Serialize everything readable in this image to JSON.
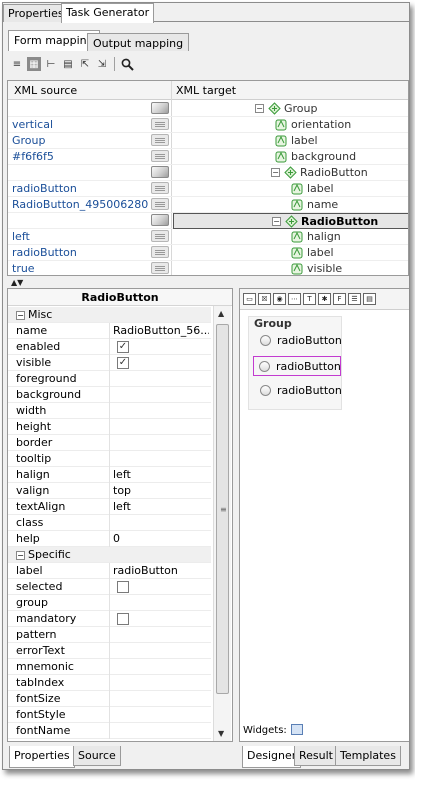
{
  "top_tabs": [
    "Properties",
    "Task Generator"
  ],
  "inner_tabs": [
    "Form mapping",
    "Output mapping"
  ],
  "toolbar_icons": [
    "list-icon",
    "grid-icon",
    "tree-icon",
    "document-icon",
    "export-icon",
    "import-icon",
    "search-icon"
  ],
  "mapping": {
    "col_source": "XML source",
    "col_target": "XML target",
    "rows": [
      {
        "source": "",
        "mid": "grad",
        "target": "Group",
        "level": 0,
        "expander": "−",
        "bold": false,
        "selected": false
      },
      {
        "source": "vertical",
        "mid": "lines",
        "target": "orientation",
        "level": 1,
        "expander": "",
        "bold": false,
        "selected": false
      },
      {
        "source": "Group",
        "mid": "lines",
        "target": "label",
        "level": 1,
        "expander": "",
        "bold": false,
        "selected": false
      },
      {
        "source": "#f6f6f5",
        "mid": "lines",
        "target": "background",
        "level": 1,
        "expander": "",
        "bold": false,
        "selected": false
      },
      {
        "source": "",
        "mid": "grad",
        "target": "RadioButton",
        "level": 1,
        "expander": "−",
        "bold": false,
        "selected": false
      },
      {
        "source": "radioButton",
        "mid": "lines",
        "target": "label",
        "level": 2,
        "expander": "",
        "bold": false,
        "selected": false
      },
      {
        "source": "RadioButton_495006280",
        "mid": "lines",
        "target": "name",
        "level": 2,
        "expander": "",
        "bold": false,
        "selected": false
      },
      {
        "source": "",
        "mid": "grad",
        "target": "RadioButton",
        "level": 1,
        "expander": "−",
        "bold": true,
        "selected": true
      },
      {
        "source": "left",
        "mid": "lines",
        "target": "halign",
        "level": 2,
        "expander": "",
        "bold": false,
        "selected": false
      },
      {
        "source": "radioButton",
        "mid": "lines",
        "target": "label",
        "level": 2,
        "expander": "",
        "bold": false,
        "selected": false
      },
      {
        "source": "true",
        "mid": "lines",
        "target": "visible",
        "level": 2,
        "expander": "",
        "bold": false,
        "selected": false
      }
    ]
  },
  "properties": {
    "title": "RadioButton",
    "rows": [
      {
        "kind": "cat",
        "name": "Misc"
      },
      {
        "kind": "text",
        "name": "name",
        "value": "RadioButton_56..."
      },
      {
        "kind": "check",
        "name": "enabled",
        "value": "✓"
      },
      {
        "kind": "check",
        "name": "visible",
        "value": "✓"
      },
      {
        "kind": "text",
        "name": "foreground",
        "value": ""
      },
      {
        "kind": "text",
        "name": "background",
        "value": ""
      },
      {
        "kind": "text",
        "name": "width",
        "value": ""
      },
      {
        "kind": "text",
        "name": "height",
        "value": ""
      },
      {
        "kind": "text",
        "name": "border",
        "value": ""
      },
      {
        "kind": "text",
        "name": "tooltip",
        "value": ""
      },
      {
        "kind": "text",
        "name": "halign",
        "value": "left"
      },
      {
        "kind": "text",
        "name": "valign",
        "value": "top"
      },
      {
        "kind": "text",
        "name": "textAlign",
        "value": "left"
      },
      {
        "kind": "text",
        "name": "class",
        "value": ""
      },
      {
        "kind": "text",
        "name": "help",
        "value": "0"
      },
      {
        "kind": "cat",
        "name": "Specific"
      },
      {
        "kind": "text",
        "name": "label",
        "value": "radioButton"
      },
      {
        "kind": "check",
        "name": "selected",
        "value": ""
      },
      {
        "kind": "text",
        "name": "group",
        "value": ""
      },
      {
        "kind": "check",
        "name": "mandatory",
        "value": ""
      },
      {
        "kind": "text",
        "name": "pattern",
        "value": ""
      },
      {
        "kind": "text",
        "name": "errorText",
        "value": ""
      },
      {
        "kind": "text",
        "name": "mnemonic",
        "value": ""
      },
      {
        "kind": "text",
        "name": "tabIndex",
        "value": ""
      },
      {
        "kind": "text",
        "name": "fontSize",
        "value": ""
      },
      {
        "kind": "text",
        "name": "fontStyle",
        "value": ""
      },
      {
        "kind": "text",
        "name": "fontName",
        "value": ""
      }
    ]
  },
  "left_bottom_tabs": [
    "Properties",
    "Source"
  ],
  "designer": {
    "palette": [
      "▭",
      "☒",
      "◉",
      "⋯",
      "T",
      "✱",
      "F",
      "☰",
      "▤"
    ],
    "group_title": "Group",
    "radios": [
      "radioButton",
      "radioButton",
      "radioButton"
    ],
    "selected_radio": 1,
    "widgets_label": "Widgets:"
  },
  "right_bottom_tabs": [
    "Designer",
    "Result",
    "Templates"
  ]
}
